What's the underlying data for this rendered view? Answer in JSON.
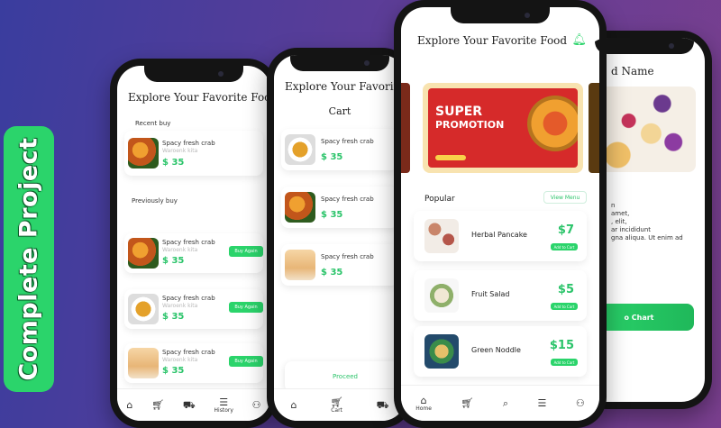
{
  "badge": "Complete Project",
  "phone1": {
    "title": "Explore Your Favorite Food",
    "recent_label": "Recent buy",
    "recent_item": {
      "name": "Spacy fresh crab",
      "sub": "Waroenk kita",
      "price": "$ 35"
    },
    "previous_label": "Previously buy",
    "previous_items": [
      {
        "name": "Spacy fresh crab",
        "sub": "Waroenk kita",
        "price": "$ 35",
        "button": "Buy Again"
      },
      {
        "name": "Spacy fresh crab",
        "sub": "Waroenk kita",
        "price": "$ 35",
        "button": "Buy Again"
      },
      {
        "name": "Spacy fresh crab",
        "sub": "Waroenk kita",
        "price": "$ 35",
        "button": "Buy Again"
      }
    ],
    "nav": {
      "history": "History"
    }
  },
  "phone2": {
    "title": "Explore Your Favorite Food",
    "cart_title": "Cart",
    "items": [
      {
        "name": "Spacy fresh crab",
        "price": "$ 35"
      },
      {
        "name": "Spacy fresh crab",
        "price": "$ 35"
      },
      {
        "name": "Spacy fresh crab",
        "price": "$ 35"
      }
    ],
    "proceed": "Proceed",
    "nav": {
      "cart": "Cart"
    }
  },
  "phone3": {
    "title": "Explore Your Favorite Food",
    "promo": {
      "line1": "SUPER",
      "line2": "PROMOTION"
    },
    "popular_label": "Popular",
    "view_menu": "View Menu",
    "items": [
      {
        "name": "Herbal Pancake",
        "price": "$7",
        "button": "Add to Cart"
      },
      {
        "name": "Fruit Salad",
        "price": "$5",
        "button": "Add to Cart"
      },
      {
        "name": "Green Noddle",
        "price": "$15",
        "button": "Add to Cart"
      }
    ],
    "nav": {
      "home": "Home"
    }
  },
  "phone4": {
    "title_fragment": "d Name",
    "desc_lines": [
      "n",
      "amet,",
      ", elit,",
      "ar incididunt",
      "gna aliqua. Ut enim ad"
    ],
    "button": "o Chart"
  },
  "colors": {
    "accent": "#2bd46b",
    "price": "#2bc46a"
  }
}
